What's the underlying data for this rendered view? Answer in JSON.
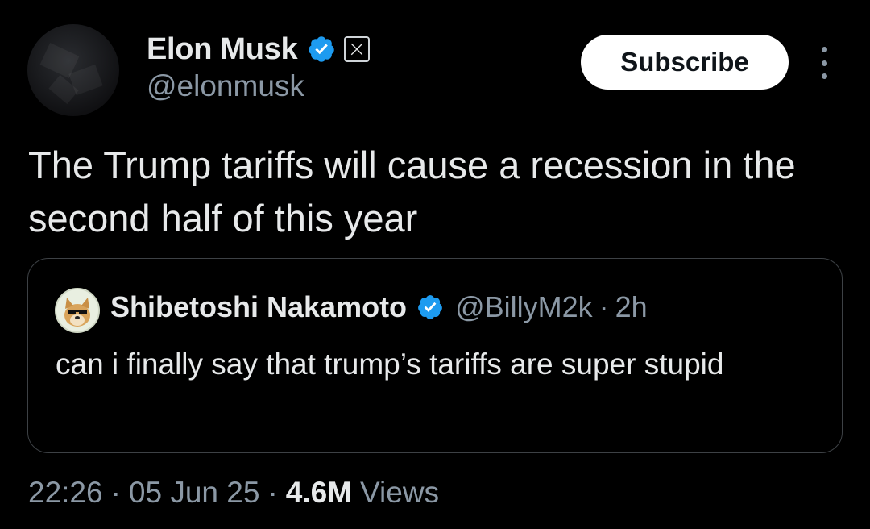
{
  "author": {
    "display_name": "Elon Musk",
    "handle": "@elonmusk",
    "verified_icon": "verified-badge-icon",
    "affiliate_icon": "x-logo-icon"
  },
  "actions": {
    "subscribe_label": "Subscribe",
    "more_icon": "more-vertical-icon"
  },
  "tweet": {
    "text": "The Trump tariffs will cause a recession in the second half of this year"
  },
  "quoted": {
    "display_name": "Shibetoshi Nakamoto",
    "handle": "@BillyM2k",
    "separator": "·",
    "time": "2h",
    "text": "can i finally say that trump’s tariffs are super stupid",
    "avatar_icon": "doge-avatar-icon"
  },
  "meta": {
    "time": "22:26",
    "date": "05 Jun 25",
    "separator": "·",
    "views_count": "4.6M",
    "views_label": "Views"
  },
  "colors": {
    "background": "#000000",
    "primary_text": "#e7e9ea",
    "secondary_text": "#8b98a5",
    "verified_blue": "#1d9bf0",
    "border": "#3d4145",
    "button_bg": "#ffffff"
  }
}
